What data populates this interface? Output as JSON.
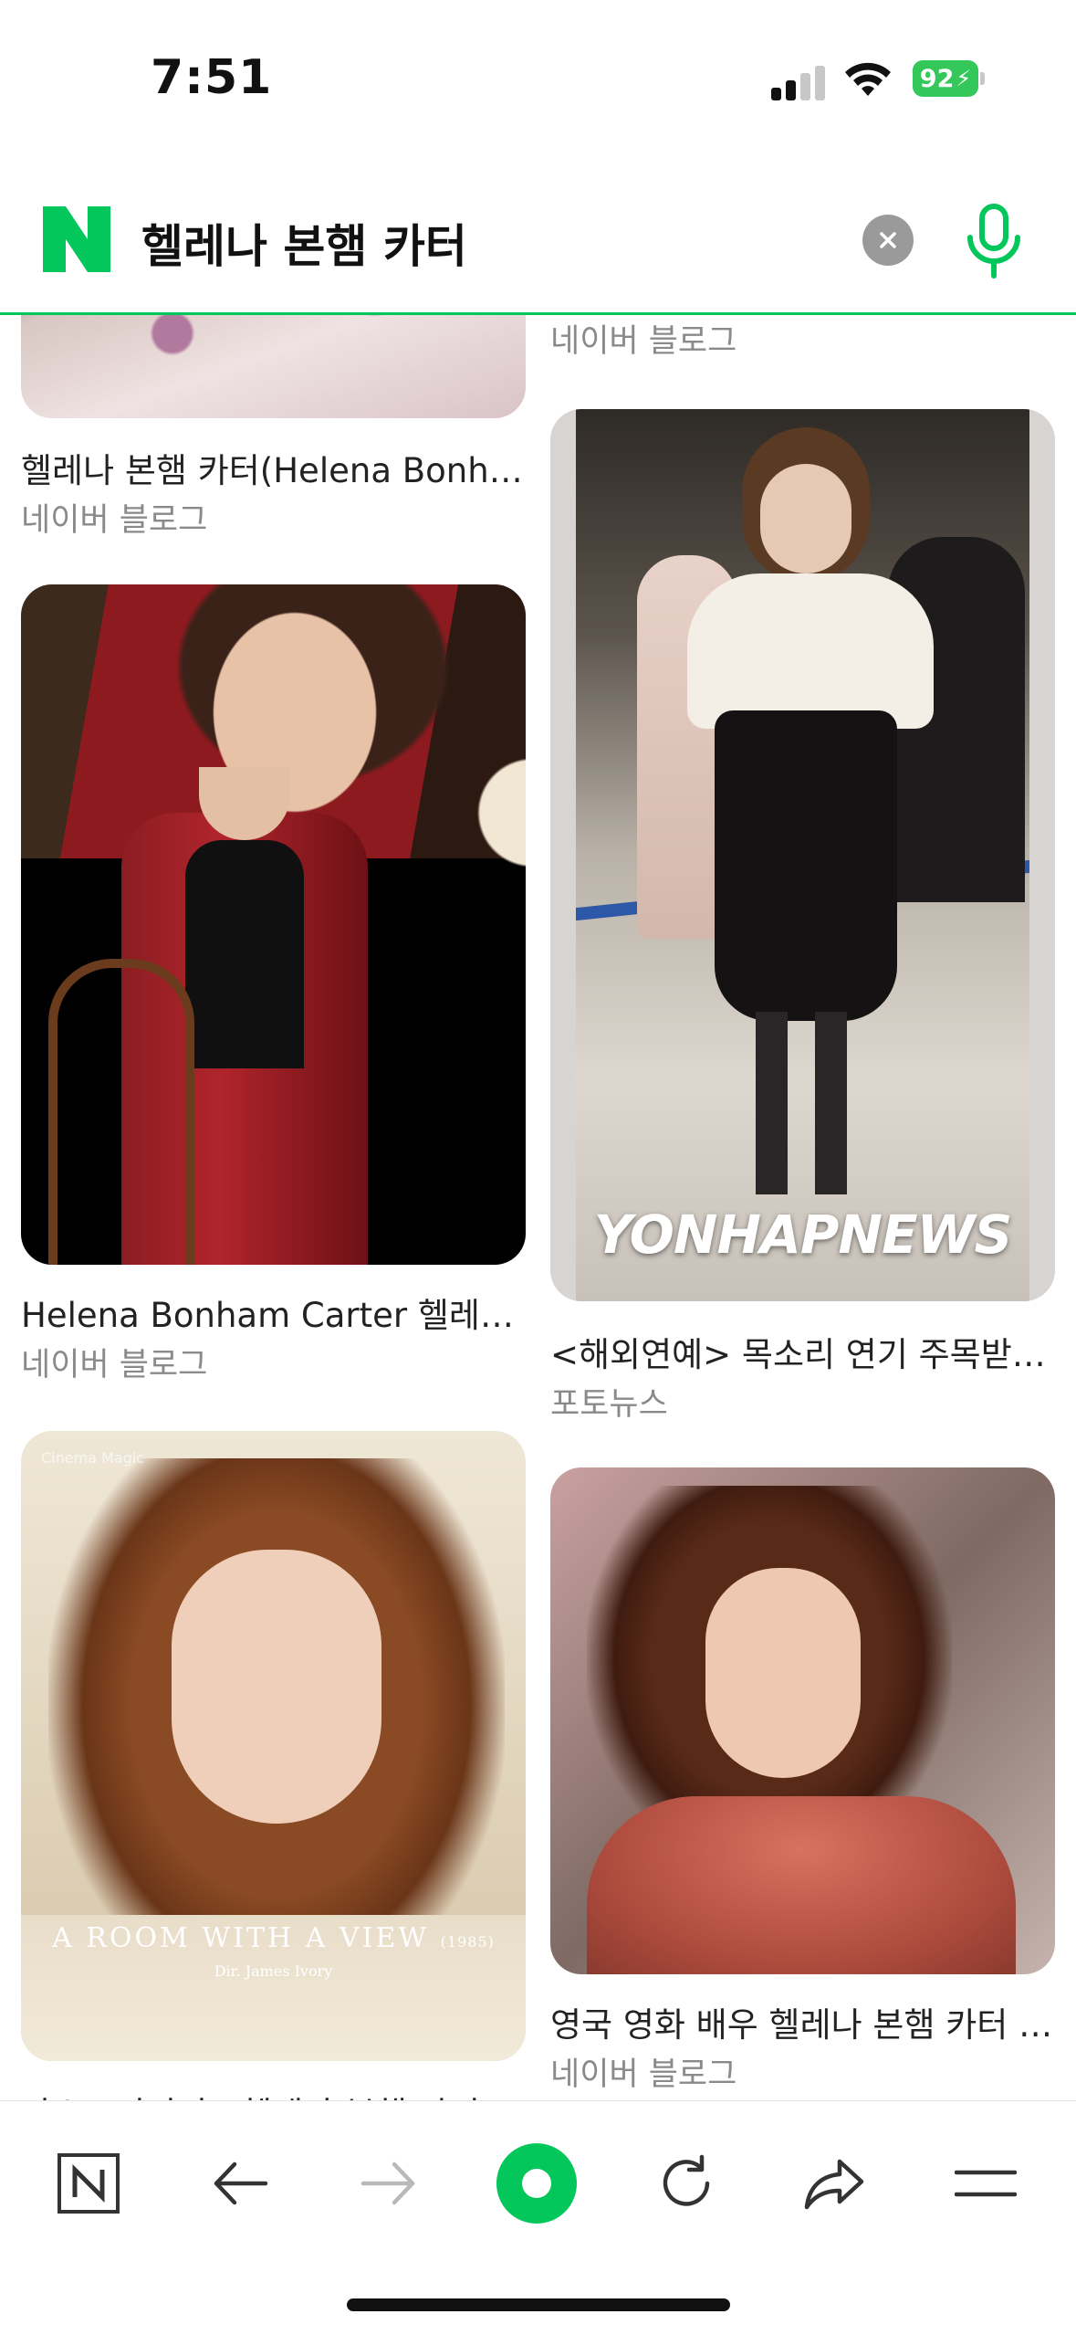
{
  "status_bar": {
    "time": "7:51",
    "battery": "92"
  },
  "search": {
    "query": "헬레나 본햄 카터"
  },
  "results": [
    {
      "title": "헬레나 본햄 카터(Helena Bonha...",
      "source": "네이버 블로그"
    },
    {
      "title": "",
      "source": "네이버 블로그"
    },
    {
      "title": "Helena Bonham Carter 헬레나 ...",
      "source": "네이버 블로그"
    },
    {
      "title": "<해외연예> 목소리 연기 주목받는 ...",
      "source": "포토뉴스",
      "watermark": "YONHAPNEWS"
    },
    {
      "title": "아스트리티미 - 헬레나 본햄 카터 E...",
      "source": "",
      "movie_title": "A ROOM WITH A VIEW",
      "movie_year": "(1985)",
      "movie_director": "Dir. James Ivory",
      "corner_text": "Cinema Magic"
    },
    {
      "title": "영국 영화 배우 헬레나 본햄 카터 패...",
      "source": "네이버 블로그"
    }
  ],
  "toolbar": {
    "items": [
      "naver-home",
      "back",
      "forward",
      "green-dot",
      "refresh",
      "share",
      "menu"
    ]
  },
  "colors": {
    "accent": "#03c75a",
    "battery": "#34c759"
  }
}
